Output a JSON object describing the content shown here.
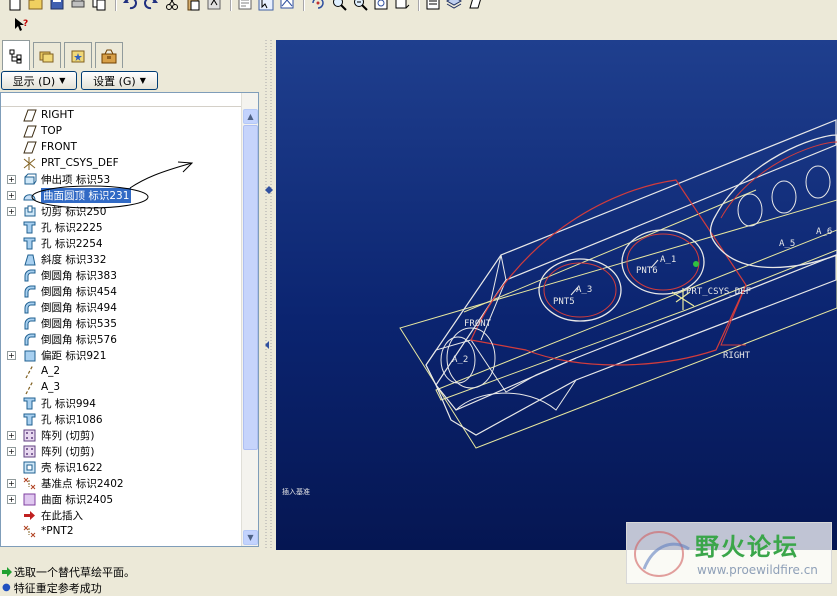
{
  "colors": {
    "accent": "#316ac5",
    "viewport_top": "#1f3f8e",
    "viewport_bottom": "#051652",
    "model_line": "#e8e8e8",
    "datum": "#e8e8a0",
    "highlight": "#d23c3c",
    "watermark_green": "#3aa64a"
  },
  "toolbar": {
    "row1_icons": [
      "new-icon",
      "open-icon",
      "save-icon",
      "print-icon",
      "copy-icon",
      "undo-icon",
      "redo-icon",
      "cut-icon",
      "paste-icon",
      "regenerate-icon",
      "find-icon",
      "select-icon",
      "repaint-icon",
      "spin-icon",
      "zoom-in-icon",
      "zoom-out-icon",
      "refit-icon",
      "orient-icon",
      "view-list-icon",
      "layers-icon",
      "datum-plane-icon"
    ],
    "row2_icons": [
      "whats-this-icon"
    ]
  },
  "panel": {
    "tabs": [
      "model-tree-tab",
      "folder-browser-tab",
      "favorites-tab",
      "connections-tab"
    ],
    "show_label": "显示 (D)",
    "settings_label": "设置 (G)"
  },
  "tree": {
    "items": [
      {
        "label": "RIGHT",
        "icon": "datum-plane-icon",
        "exp": ""
      },
      {
        "label": "TOP",
        "icon": "datum-plane-icon",
        "exp": ""
      },
      {
        "label": "FRONT",
        "icon": "datum-plane-icon",
        "exp": ""
      },
      {
        "label": "PRT_CSYS_DEF",
        "icon": "csys-icon",
        "exp": ""
      },
      {
        "label": "伸出项 标识53",
        "icon": "extrude-icon",
        "exp": "+"
      },
      {
        "label": "曲面圆顶 标识231",
        "icon": "dome-icon",
        "exp": "+",
        "selected": true
      },
      {
        "label": "切剪 标识250",
        "icon": "cut-icon",
        "exp": "+"
      },
      {
        "label": "孔 标识2225",
        "icon": "hole-icon",
        "exp": ""
      },
      {
        "label": "孔 标识2254",
        "icon": "hole-icon",
        "exp": ""
      },
      {
        "label": "斜度 标识332",
        "icon": "draft-icon",
        "exp": ""
      },
      {
        "label": "倒圆角 标识383",
        "icon": "round-icon",
        "exp": ""
      },
      {
        "label": "倒圆角 标识454",
        "icon": "round-icon",
        "exp": ""
      },
      {
        "label": "倒圆角 标识494",
        "icon": "round-icon",
        "exp": ""
      },
      {
        "label": "倒圆角 标识535",
        "icon": "round-icon",
        "exp": ""
      },
      {
        "label": "倒圆角 标识576",
        "icon": "round-icon",
        "exp": ""
      },
      {
        "label": "偏距 标识921",
        "icon": "offset-icon",
        "exp": "+"
      },
      {
        "label": "A_2",
        "icon": "axis-icon",
        "exp": ""
      },
      {
        "label": "A_3",
        "icon": "axis-icon",
        "exp": ""
      },
      {
        "label": "孔 标识994",
        "icon": "hole-icon",
        "exp": ""
      },
      {
        "label": "孔 标识1086",
        "icon": "hole-icon",
        "exp": ""
      },
      {
        "label": "阵列 (切剪)",
        "icon": "pattern-icon",
        "exp": "+"
      },
      {
        "label": "阵列 (切剪)",
        "icon": "pattern-icon",
        "exp": "+"
      },
      {
        "label": "壳 标识1622",
        "icon": "shell-icon",
        "exp": ""
      },
      {
        "label": "基准点 标识2402",
        "icon": "datum-point-icon",
        "exp": "+"
      },
      {
        "label": "曲面 标识2405",
        "icon": "surface-icon",
        "exp": "+"
      },
      {
        "label": "在此插入",
        "icon": "insert-here-icon",
        "exp": ""
      },
      {
        "label": "*PNT2",
        "icon": "datum-point-icon",
        "exp": ""
      }
    ]
  },
  "viewport": {
    "labels": {
      "front": "FRONT",
      "right": "RIGHT",
      "csys": "PRT_CSYS_DEF",
      "pnt5": "PNT5",
      "pnt6": "PNT6",
      "a1": "A_1",
      "a2": "A_2",
      "a3": "A_3",
      "a5": "A_5",
      "a6": "A_6",
      "corner_note": "插入基准"
    }
  },
  "status": {
    "line1": "选取一个替代草绘平面。",
    "line2": "特征重定参考成功"
  },
  "watermark": {
    "cn": "野火论坛",
    "url": "www.proewildfire.cn"
  }
}
